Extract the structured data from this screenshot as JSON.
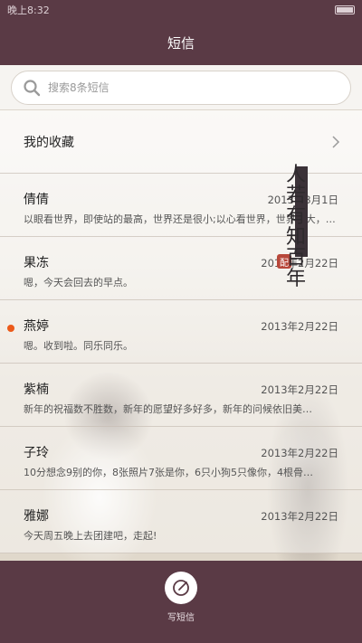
{
  "status_bar": {
    "time": "晚上8:32"
  },
  "header": {
    "title": "短信"
  },
  "search": {
    "placeholder": "搜索8条短信"
  },
  "favorites": {
    "label": "我的收藏"
  },
  "messages": [
    {
      "name": "倩倩",
      "date": "2013年3月1日",
      "preview": "以眼看世界，即使站的最高，世界还是很小;以心看世界，世界再大，心也能装下。即使身…",
      "unread": false
    },
    {
      "name": "果冻",
      "date": "2013年2月22日",
      "preview": "嗯，今天会回去的早点。",
      "unread": false
    },
    {
      "name": "燕婷",
      "date": "2013年2月22日",
      "preview": "嗯。收到啦。同乐同乐。",
      "unread": true
    },
    {
      "name": "紫楠",
      "date": "2013年2月22日",
      "preview": "新年的祝福数不胜数，新年的愿望好多好多，新年的问候依旧美…",
      "unread": false
    },
    {
      "name": "子玲",
      "date": "2013年2月22日",
      "preview": "10分想念9别的你，8张照片7张是你，6只小狗5只像你，4根骨…",
      "unread": false
    },
    {
      "name": "雅娜",
      "date": "2013年2月22日",
      "preview": "今天周五晚上去团建吧，走起!",
      "unread": false
    }
  ],
  "decoration": {
    "chars": [
      "人",
      "若",
      "有",
      "知",
      "百",
      "年"
    ],
    "seal": "配"
  },
  "bottom_bar": {
    "compose_label": "写短信"
  },
  "colors": {
    "bar": "#5a3a45",
    "unread_dot": "#ec5a1a"
  }
}
